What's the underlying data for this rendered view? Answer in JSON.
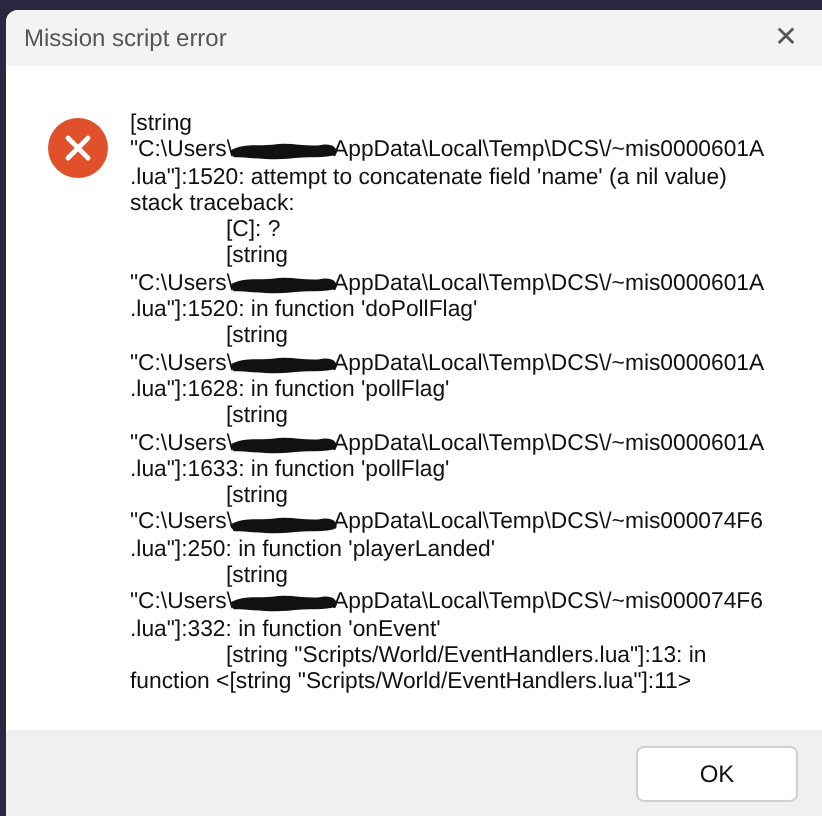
{
  "window": {
    "title": "Mission script error",
    "close": "✕"
  },
  "lines": [
    {
      "kind": "text",
      "text": "[string"
    },
    {
      "kind": "path",
      "before": "\"C:\\Users\\",
      "after": "AppData\\Local\\Temp\\DCS\\/~mis0000601A"
    },
    {
      "kind": "text",
      "text": ".lua\"]:1520: attempt to concatenate field 'name' (a nil value)"
    },
    {
      "kind": "text",
      "text": "stack traceback:"
    },
    {
      "kind": "indented",
      "text": "[C]: ?"
    },
    {
      "kind": "indented",
      "text": "[string"
    },
    {
      "kind": "path",
      "before": "\"C:\\Users\\",
      "after": "AppData\\Local\\Temp\\DCS\\/~mis0000601A"
    },
    {
      "kind": "text",
      "text": ".lua\"]:1520: in function 'doPollFlag'"
    },
    {
      "kind": "indented",
      "text": "[string"
    },
    {
      "kind": "path",
      "before": "\"C:\\Users\\",
      "after": "AppData\\Local\\Temp\\DCS\\/~mis0000601A"
    },
    {
      "kind": "text",
      "text": ".lua\"]:1628: in function 'pollFlag'"
    },
    {
      "kind": "indented",
      "text": "[string"
    },
    {
      "kind": "path",
      "before": "\"C:\\Users\\",
      "after": "AppData\\Local\\Temp\\DCS\\/~mis0000601A"
    },
    {
      "kind": "text",
      "text": ".lua\"]:1633: in function 'pollFlag'"
    },
    {
      "kind": "indented",
      "text": "[string"
    },
    {
      "kind": "path",
      "before": "\"C:\\Users\\",
      "after": "AppData\\Local\\Temp\\DCS\\/~mis000074F6"
    },
    {
      "kind": "text",
      "text": ".lua\"]:250: in function 'playerLanded'"
    },
    {
      "kind": "indented",
      "text": "[string"
    },
    {
      "kind": "path",
      "before": "\"C:\\Users\\",
      "after": "AppData\\Local\\Temp\\DCS\\/~mis000074F6"
    },
    {
      "kind": "text",
      "text": ".lua\"]:332: in function 'onEvent'"
    },
    {
      "kind": "indented",
      "text": "[string \"Scripts/World/EventHandlers.lua\"]:13: in"
    },
    {
      "kind": "text",
      "text": "function <[string \"Scripts/World/EventHandlers.lua\"]:11>"
    }
  ],
  "buttons": [
    "OK"
  ]
}
